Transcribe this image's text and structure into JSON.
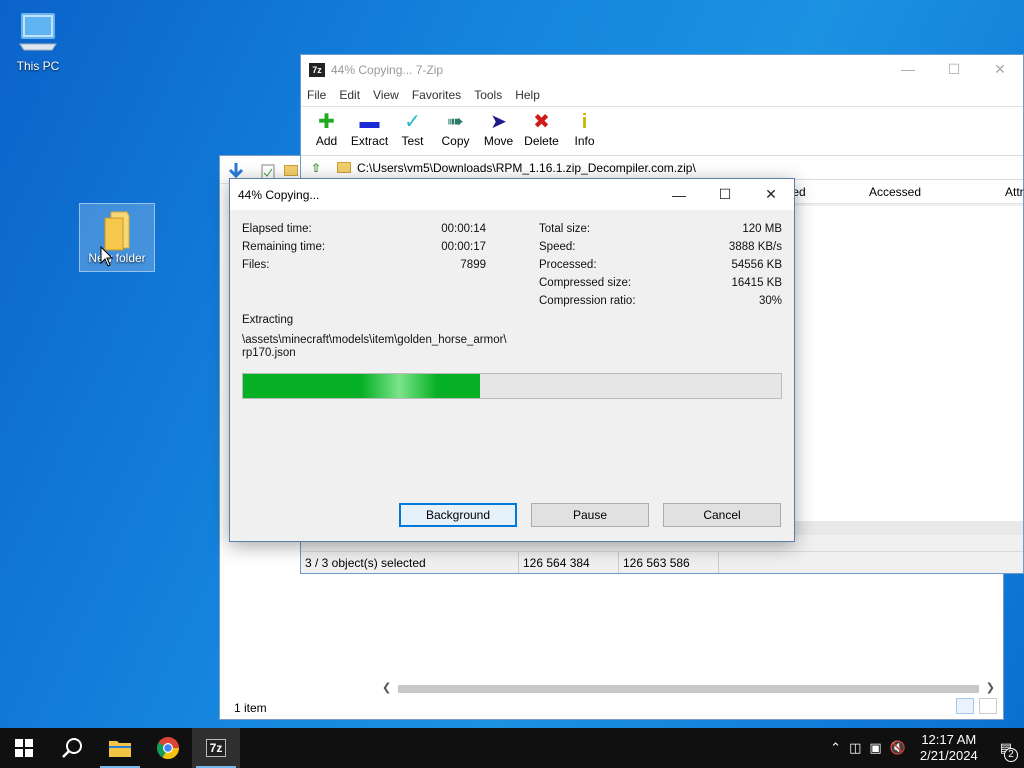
{
  "desktop": {
    "icons": [
      {
        "label": "This PC"
      },
      {
        "label": "New folder"
      }
    ]
  },
  "explorer": {
    "status": "1 item"
  },
  "zip_window": {
    "title": "44% Copying... 7-Zip",
    "app_icon": "7z",
    "menu": [
      "File",
      "Edit",
      "View",
      "Favorites",
      "Tools",
      "Help"
    ],
    "toolbar": [
      {
        "label": "Add",
        "icon": "plus-icon",
        "color": "#1faa1f"
      },
      {
        "label": "Extract",
        "icon": "minus-icon",
        "color": "#1a2bd6"
      },
      {
        "label": "Test",
        "icon": "check-icon",
        "color": "#22b8c8"
      },
      {
        "label": "Copy",
        "icon": "double-arrow-icon",
        "color": "#2a7a6a"
      },
      {
        "label": "Move",
        "icon": "arrow-right-icon",
        "color": "#1a1a8a"
      },
      {
        "label": "Delete",
        "icon": "x-icon",
        "color": "#d11a1a"
      },
      {
        "label": "Info",
        "icon": "info-icon",
        "color": "#c8b400"
      }
    ],
    "path": "C:\\Users\\vm5\\Downloads\\RPM_1.16.1.zip_Decompiler.com.zip\\",
    "columns": [
      "ted",
      "Accessed",
      "Attri"
    ],
    "statusbar": [
      "3 / 3 object(s) selected",
      "126 564 384",
      "126 563 586"
    ]
  },
  "dialog": {
    "title": "44% Copying...",
    "left_stats": [
      {
        "label": "Elapsed time:",
        "value": "00:00:14"
      },
      {
        "label": "Remaining time:",
        "value": "00:00:17"
      },
      {
        "label": "Files:",
        "value": "7899"
      }
    ],
    "right_stats": [
      {
        "label": "Total size:",
        "value": "120 MB"
      },
      {
        "label": "Speed:",
        "value": "3888 KB/s"
      },
      {
        "label": "Processed:",
        "value": "54556 KB"
      },
      {
        "label": "Compressed size:",
        "value": "16415 KB"
      },
      {
        "label": "Compression ratio:",
        "value": "30%"
      }
    ],
    "operation": "Extracting",
    "file_line1": "\\assets\\minecraft\\models\\item\\golden_horse_armor\\",
    "file_line2": "rp170.json",
    "progress_percent": 44,
    "buttons": {
      "background": "Background",
      "pause": "Pause",
      "cancel": "Cancel"
    }
  },
  "taskbar": {
    "pinned": [
      "start-icon",
      "search-icon",
      "file-explorer-icon",
      "chrome-icon",
      "7zip-icon"
    ],
    "time": "12:17 AM",
    "date": "2/21/2024",
    "notification_count": "2"
  }
}
